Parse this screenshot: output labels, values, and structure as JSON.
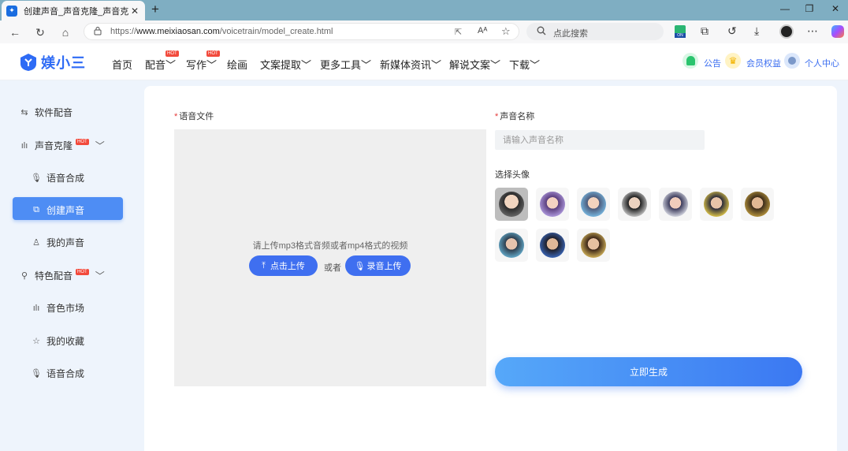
{
  "browser": {
    "tab_title": "创建声音_声音克隆_声音克隆定制",
    "url_prefix": "https://",
    "url_host": "www.meixiaosan.com",
    "url_path": "/voicetrain/model_create.html",
    "search_placeholder": "点此搜索",
    "colors": {
      "tabbar": "#7faec2",
      "toolbar": "#f7f7f8"
    }
  },
  "header": {
    "logo_text": "媄小三",
    "nav": [
      "首页",
      "配音",
      "写作",
      "绘画",
      "文案提取",
      "更多工具",
      "新媒体资讯",
      "解说文案",
      "下载"
    ],
    "hot_badge": "HOT",
    "announcement": "公告",
    "member": "会员权益",
    "user_center": "个人中心",
    "brand_color": "#2e6bf5"
  },
  "sidebar": {
    "items": [
      {
        "label": "软件配音",
        "icon": "swap-icon"
      },
      {
        "label": "声音克隆",
        "icon": "waveform-icon",
        "hot": true
      },
      {
        "label": "语音合成",
        "icon": "microphone-icon"
      },
      {
        "label": "创建声音",
        "icon": "copy-icon",
        "active": true
      },
      {
        "label": "我的声音",
        "icon": "user-icon"
      },
      {
        "label": "特色配音",
        "icon": "search-icon",
        "hot": true
      },
      {
        "label": "音色市场",
        "icon": "waveform-icon"
      },
      {
        "label": "我的收藏",
        "icon": "star-icon"
      },
      {
        "label": "语音合成",
        "icon": "microphone-icon"
      }
    ],
    "active_color": "#4e8df4"
  },
  "form": {
    "required_mark": "*",
    "audio_label": "语音文件",
    "upload_hint": "请上传mp3格式音频或者mp4格式的视频",
    "upload_button": "点击上传",
    "or_text": "或者",
    "record_button": "录音上传",
    "name_label": "声音名称",
    "name_placeholder": "请输入声音名称",
    "avatar_label": "选择头像",
    "avatar_count": 10,
    "selected_avatar": 1,
    "generate_button": "立即生成"
  }
}
